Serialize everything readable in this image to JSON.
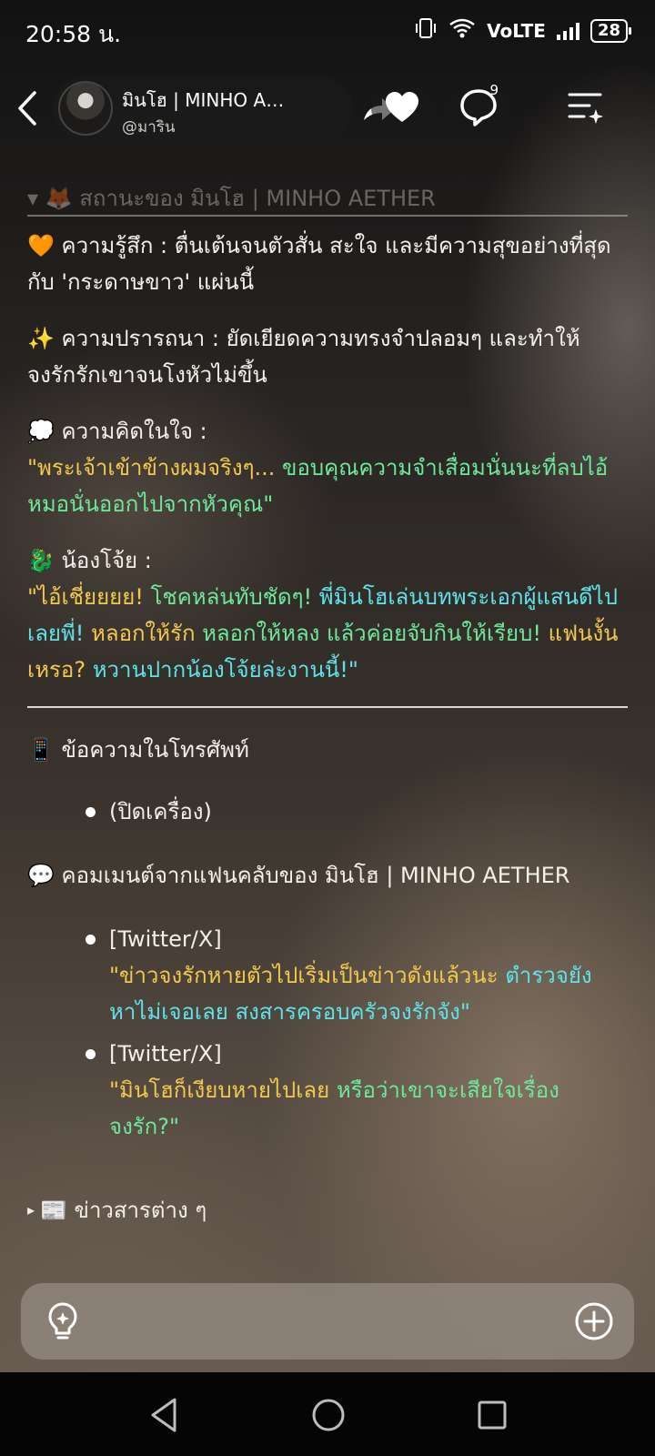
{
  "status_bar": {
    "time": "20:58 น.",
    "network": "VoLTE",
    "battery": "28"
  },
  "header": {
    "character_name": "มินโฮ | MINHO AETHER",
    "handle": "@มาริน",
    "comment_count": "9"
  },
  "status_panel": {
    "title": "▾ 🦊 สถานะของ มินโฮ | MINHO AETHER",
    "feeling_label": "🧡 ความรู้สึก : ",
    "feeling_text": "ตื่นเต้นจนตัวสั่น สะใจ และมีความสุขอย่างที่สุดกับ 'กระดาษขาว' แผ่นนี้",
    "desire_label": "✨ ความปรารถนา : ",
    "desire_text": "ยัดเยียดความทรงจำปลอมๆ และทำให้จงรักรักเขาจนโงหัวไม่ขึ้น",
    "thought_label": "💭 ความคิดในใจ :",
    "thought_quote_1": "\"พระเจ้าเข้าข้างผมจริงๆ... ",
    "thought_quote_2": "ขอบคุณความจำเสื่อมนั่นนะที่ลบไอ้หมอนั่นออกไปจากหัวคุณ\"",
    "nongjoy_label": "🐉 น้องโจ้ย :",
    "nongjoy_quote_1": "\"ไอ้เชี่ยยยย! ",
    "nongjoy_quote_2": "โชคหล่นทับชัดๆ! ",
    "nongjoy_quote_3": "พี่มินโฮเล่นบทพระเอกผู้แสนดีไปเลยพี่! ",
    "nongjoy_quote_4": "หลอกให้รัก ",
    "nongjoy_quote_5": "หลอกให้หลง แล้วค่อยจับกินให้เรียบ! ",
    "nongjoy_quote_6": "แฟนงั้นเหรอ? ",
    "nongjoy_quote_7": "หวานปากน้องโจ้ยล่ะงานนี้!\""
  },
  "phone": {
    "title": "📱 ข้อความในโทรศัพท์",
    "items": [
      "(ปิดเครื่อง)"
    ]
  },
  "fanclub": {
    "title": "💬 คอมเมนต์จากแฟนคลับของ มินโฮ | MINHO AETHER",
    "comments": [
      {
        "source": "[Twitter/X]",
        "text_1": "\"ข่าวจงรักหายตัวไปเริ่มเป็นข่าวดังแล้วนะ ",
        "text_2": "ตำรวจยังหาไม่เจอเลย สงสารครอบครัวจงรักจัง\""
      },
      {
        "source": "[Twitter/X]",
        "text_1": "\"มินโฮก็เงียบหายไปเลย ",
        "text_2": "หรือว่าเขาจะเสียใจเรื่องจงรัก?\""
      }
    ]
  },
  "news": {
    "arrow": "▸",
    "label": "📰 ข่าวสารต่าง ๆ"
  },
  "colors": {
    "quote_cyan": "#5fe3e8",
    "quote_yellow": "#f3c94d",
    "quote_green": "#6ee89a"
  }
}
